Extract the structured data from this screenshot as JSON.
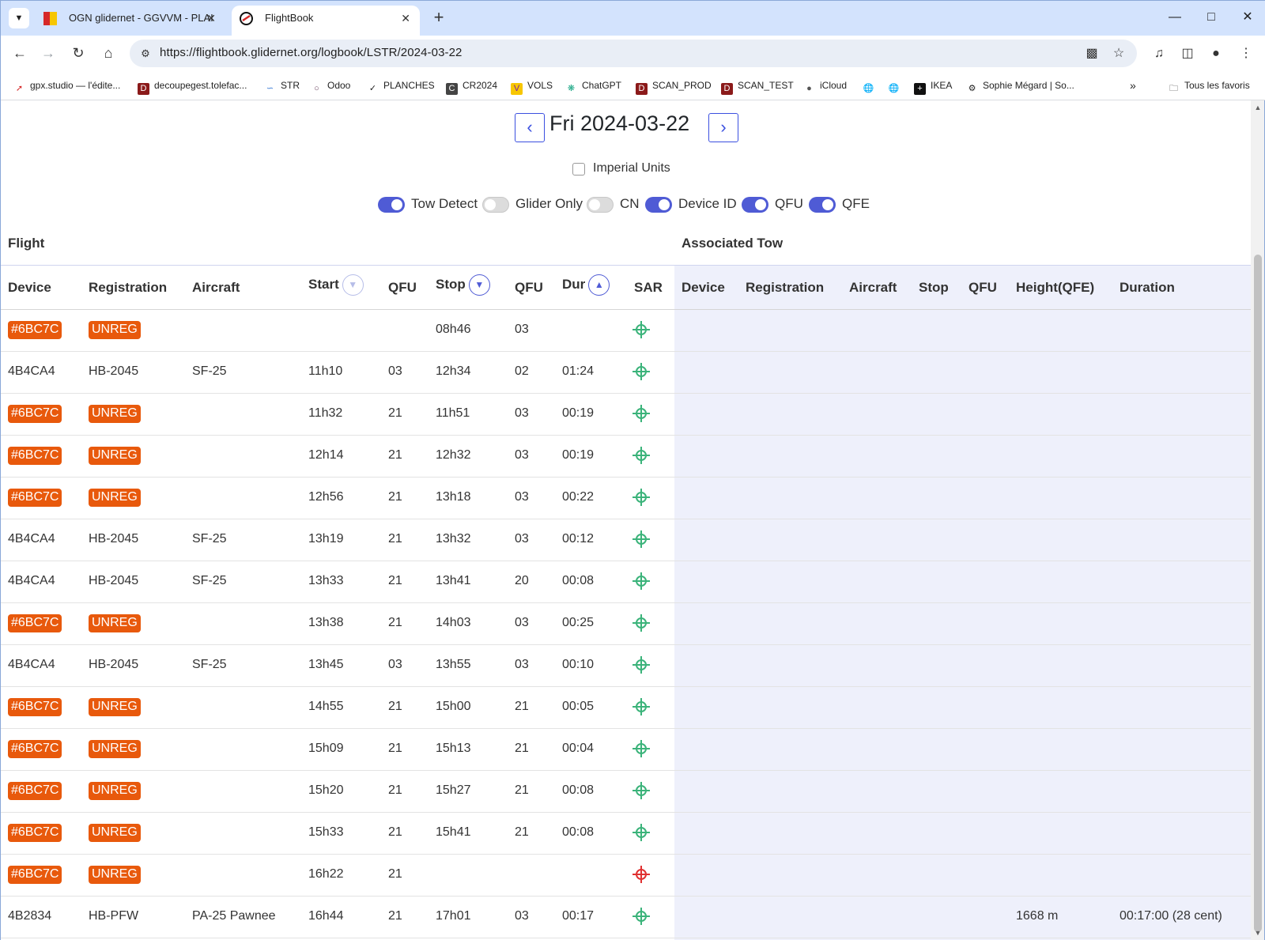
{
  "browser": {
    "tabs": [
      {
        "title": "OGN glidernet - GGVVM - PLAI",
        "active": false
      },
      {
        "title": "FlightBook",
        "active": true
      }
    ],
    "url": "https://flightbook.glidernet.org/logbook/LSTR/2024-03-22",
    "bookmarks": [
      "gpx.studio — l'édite...",
      "decoupegest.tolefac...",
      "STR",
      "Odoo",
      "PLANCHES",
      "CR2024",
      "VOLS",
      "ChatGPT",
      "SCAN_PROD",
      "SCAN_TEST",
      "iCloud",
      "IKEA",
      "Sophie Mégard | So..."
    ],
    "all_bookmarks": "Tous les favoris"
  },
  "page": {
    "date_title": "Fri 2024-03-22",
    "imperial_label": "Imperial Units",
    "imperial_checked": false,
    "toggles": [
      {
        "label": "Tow Detect",
        "on": true
      },
      {
        "label": "Glider Only",
        "on": false
      },
      {
        "label": "CN",
        "on": false
      },
      {
        "label": "Device ID",
        "on": true
      },
      {
        "label": "QFU",
        "on": true
      },
      {
        "label": "QFE",
        "on": true
      }
    ],
    "flight_section": "Flight",
    "tow_section": "Associated Tow",
    "flight_headers": {
      "device": "Device",
      "registration": "Registration",
      "aircraft": "Aircraft",
      "start": "Start",
      "qfu1": "QFU",
      "stop": "Stop",
      "qfu2": "QFU",
      "dur": "Dur",
      "sar": "SAR"
    },
    "tow_headers": {
      "device": "Device",
      "registration": "Registration",
      "aircraft": "Aircraft",
      "stop": "Stop",
      "qfu": "QFU",
      "height": "Height(QFE)",
      "duration": "Duration"
    },
    "colors": {
      "badge": "#e8590c",
      "sar_ok": "#3bb37a",
      "sar_alert": "#e03131",
      "accent": "#4f5bd5"
    },
    "flights": [
      {
        "device": "#6BC7C",
        "registration": "UNREG",
        "aircraft": "",
        "start": "",
        "qfu1": "",
        "stop": "08h46",
        "qfu2": "03",
        "dur": "",
        "badge": true,
        "sar": "ok",
        "tow_height": "",
        "tow_duration": ""
      },
      {
        "device": "4B4CA4",
        "registration": "HB-2045",
        "aircraft": "SF-25",
        "start": "11h10",
        "qfu1": "03",
        "stop": "12h34",
        "qfu2": "02",
        "dur": "01:24",
        "badge": false,
        "sar": "ok",
        "tow_height": "",
        "tow_duration": ""
      },
      {
        "device": "#6BC7C",
        "registration": "UNREG",
        "aircraft": "",
        "start": "11h32",
        "qfu1": "21",
        "stop": "11h51",
        "qfu2": "03",
        "dur": "00:19",
        "badge": true,
        "sar": "ok",
        "tow_height": "",
        "tow_duration": ""
      },
      {
        "device": "#6BC7C",
        "registration": "UNREG",
        "aircraft": "",
        "start": "12h14",
        "qfu1": "21",
        "stop": "12h32",
        "qfu2": "03",
        "dur": "00:19",
        "badge": true,
        "sar": "ok",
        "tow_height": "",
        "tow_duration": ""
      },
      {
        "device": "#6BC7C",
        "registration": "UNREG",
        "aircraft": "",
        "start": "12h56",
        "qfu1": "21",
        "stop": "13h18",
        "qfu2": "03",
        "dur": "00:22",
        "badge": true,
        "sar": "ok",
        "tow_height": "",
        "tow_duration": ""
      },
      {
        "device": "4B4CA4",
        "registration": "HB-2045",
        "aircraft": "SF-25",
        "start": "13h19",
        "qfu1": "21",
        "stop": "13h32",
        "qfu2": "03",
        "dur": "00:12",
        "badge": false,
        "sar": "ok",
        "tow_height": "",
        "tow_duration": ""
      },
      {
        "device": "4B4CA4",
        "registration": "HB-2045",
        "aircraft": "SF-25",
        "start": "13h33",
        "qfu1": "21",
        "stop": "13h41",
        "qfu2": "20",
        "dur": "00:08",
        "badge": false,
        "sar": "ok",
        "tow_height": "",
        "tow_duration": ""
      },
      {
        "device": "#6BC7C",
        "registration": "UNREG",
        "aircraft": "",
        "start": "13h38",
        "qfu1": "21",
        "stop": "14h03",
        "qfu2": "03",
        "dur": "00:25",
        "badge": true,
        "sar": "ok",
        "tow_height": "",
        "tow_duration": ""
      },
      {
        "device": "4B4CA4",
        "registration": "HB-2045",
        "aircraft": "SF-25",
        "start": "13h45",
        "qfu1": "03",
        "stop": "13h55",
        "qfu2": "03",
        "dur": "00:10",
        "badge": false,
        "sar": "ok",
        "tow_height": "",
        "tow_duration": ""
      },
      {
        "device": "#6BC7C",
        "registration": "UNREG",
        "aircraft": "",
        "start": "14h55",
        "qfu1": "21",
        "stop": "15h00",
        "qfu2": "21",
        "dur": "00:05",
        "badge": true,
        "sar": "ok",
        "tow_height": "",
        "tow_duration": ""
      },
      {
        "device": "#6BC7C",
        "registration": "UNREG",
        "aircraft": "",
        "start": "15h09",
        "qfu1": "21",
        "stop": "15h13",
        "qfu2": "21",
        "dur": "00:04",
        "badge": true,
        "sar": "ok",
        "tow_height": "",
        "tow_duration": ""
      },
      {
        "device": "#6BC7C",
        "registration": "UNREG",
        "aircraft": "",
        "start": "15h20",
        "qfu1": "21",
        "stop": "15h27",
        "qfu2": "21",
        "dur": "00:08",
        "badge": true,
        "sar": "ok",
        "tow_height": "",
        "tow_duration": ""
      },
      {
        "device": "#6BC7C",
        "registration": "UNREG",
        "aircraft": "",
        "start": "15h33",
        "qfu1": "21",
        "stop": "15h41",
        "qfu2": "21",
        "dur": "00:08",
        "badge": true,
        "sar": "ok",
        "tow_height": "",
        "tow_duration": ""
      },
      {
        "device": "#6BC7C",
        "registration": "UNREG",
        "aircraft": "",
        "start": "16h22",
        "qfu1": "21",
        "stop": "",
        "qfu2": "",
        "dur": "",
        "badge": true,
        "sar": "alert",
        "tow_height": "",
        "tow_duration": ""
      },
      {
        "device": "4B2834",
        "registration": "HB-PFW",
        "aircraft": "PA-25 Pawnee",
        "start": "16h44",
        "qfu1": "21",
        "stop": "17h01",
        "qfu2": "03",
        "dur": "00:17",
        "badge": false,
        "sar": "ok",
        "tow_height": "1668 m",
        "tow_duration": "00:17:00 (28 cent)"
      }
    ]
  }
}
